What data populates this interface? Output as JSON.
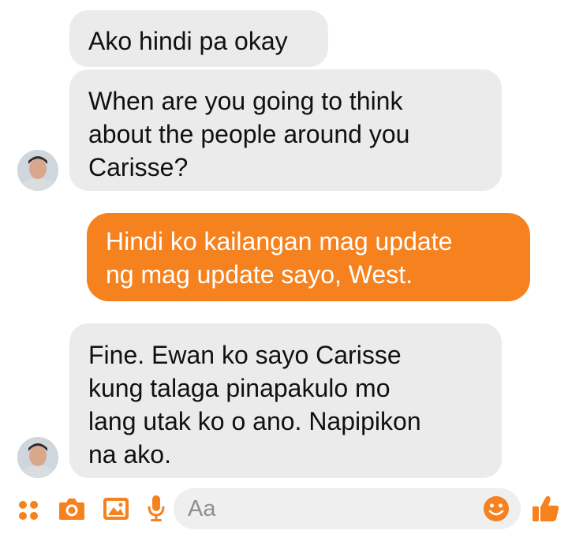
{
  "colors": {
    "accent": "#f6821f",
    "incoming_bubble": "#ebebeb",
    "incoming_text": "#111111",
    "outgoing_text": "#ffffff",
    "input_background": "#efefef",
    "placeholder": "#8f8f8f"
  },
  "messages": [
    {
      "sender": "contact",
      "text": "Ako hindi pa okay"
    },
    {
      "sender": "contact",
      "text": "When are you going to think\nabout the people around you\nCarisse?"
    },
    {
      "sender": "me",
      "text": "Hindi ko kailangan mag update\nng mag update sayo,  West."
    },
    {
      "sender": "contact",
      "text": "Fine. Ewan ko sayo Carisse\nkung talaga pinapakulo mo\nlang utak ko o ano. Napipikon\nna ako."
    }
  ],
  "composer": {
    "placeholder": "Aa",
    "icons": [
      "more-apps-icon",
      "camera-icon",
      "gallery-icon",
      "microphone-icon",
      "emoji-icon",
      "thumbs-up-icon"
    ]
  }
}
